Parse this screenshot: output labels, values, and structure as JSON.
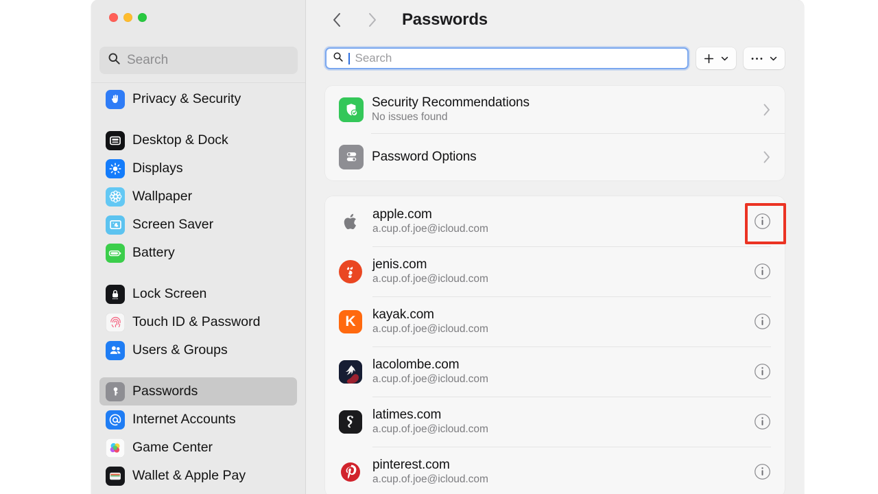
{
  "window": {
    "traffic_lights": [
      "close",
      "minimize",
      "zoom"
    ],
    "sidebar": {
      "search_placeholder": "Search",
      "items": [
        {
          "label": "Privacy & Security",
          "icon": "hand-raised-icon",
          "selected": false,
          "gap_after": true
        },
        {
          "label": "Desktop & Dock",
          "icon": "desktop-dock-icon",
          "selected": false
        },
        {
          "label": "Displays",
          "icon": "brightness-icon",
          "selected": false
        },
        {
          "label": "Wallpaper",
          "icon": "wallpaper-icon",
          "selected": false
        },
        {
          "label": "Screen Saver",
          "icon": "screen-saver-icon",
          "selected": false
        },
        {
          "label": "Battery",
          "icon": "battery-icon",
          "selected": false,
          "gap_after": true
        },
        {
          "label": "Lock Screen",
          "icon": "lock-screen-icon",
          "selected": false
        },
        {
          "label": "Touch ID & Password",
          "icon": "fingerprint-icon",
          "selected": false
        },
        {
          "label": "Users & Groups",
          "icon": "users-groups-icon",
          "selected": false,
          "gap_after": true
        },
        {
          "label": "Passwords",
          "icon": "key-icon",
          "selected": true
        },
        {
          "label": "Internet Accounts",
          "icon": "at-sign-icon",
          "selected": false
        },
        {
          "label": "Game Center",
          "icon": "game-center-icon",
          "selected": false
        },
        {
          "label": "Wallet & Apple Pay",
          "icon": "wallet-icon",
          "selected": false
        }
      ]
    }
  },
  "header": {
    "back_label": "Back",
    "forward_label": "Forward",
    "title": "Passwords"
  },
  "toolbar": {
    "search_placeholder": "Search",
    "search_value": "",
    "add_label": "Add",
    "more_label": "More"
  },
  "options_card": {
    "rows": [
      {
        "title": "Security Recommendations",
        "subtitle": "No issues found",
        "icon": "shield-check-icon",
        "icon_bg": "#34c759"
      },
      {
        "title": "Password Options",
        "subtitle": "",
        "icon": "password-options-icon",
        "icon_bg": "#8e8e93"
      }
    ]
  },
  "passwords_card": {
    "rows": [
      {
        "site": "apple.com",
        "account": "a.cup.of.joe@icloud.com",
        "icon": "apple-logo-icon",
        "icon_bg": "#f7f7f7",
        "highlighted": true
      },
      {
        "site": "jenis.com",
        "account": "a.cup.of.joe@icloud.com",
        "icon": "jenis-logo-icon",
        "icon_bg": "#ea4722",
        "highlighted": false
      },
      {
        "site": "kayak.com",
        "account": "a.cup.of.joe@icloud.com",
        "icon": "kayak-logo-icon",
        "icon_bg": "#ff690f",
        "highlighted": false
      },
      {
        "site": "lacolombe.com",
        "account": "a.cup.of.joe@icloud.com",
        "icon": "lacolombe-logo-icon",
        "icon_bg": "#1a2138",
        "highlighted": false
      },
      {
        "site": "latimes.com",
        "account": "a.cup.of.joe@icloud.com",
        "icon": "latimes-logo-icon",
        "icon_bg": "#1c1c1e",
        "highlighted": false
      },
      {
        "site": "pinterest.com",
        "account": "a.cup.of.joe@icloud.com",
        "icon": "pinterest-logo-icon",
        "icon_bg": "#f7f7f7",
        "highlighted": false
      }
    ],
    "info_button_label": "Info"
  },
  "annotation": {
    "highlight_color": "#eb3323",
    "target": "apple.com info button"
  }
}
